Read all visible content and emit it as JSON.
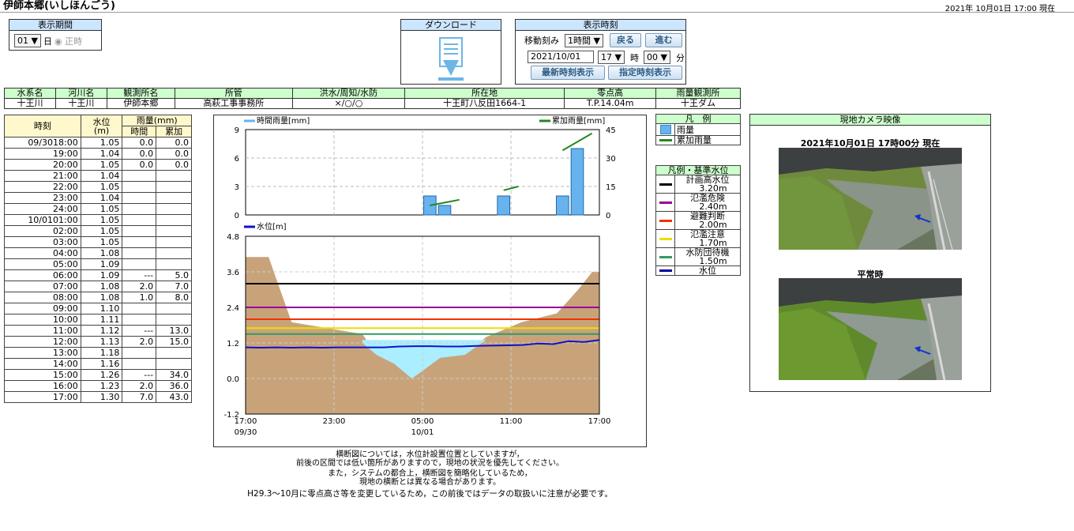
{
  "header": {
    "title": "伊師本郷(いしほんごう)",
    "current": "2021年 10月01日 17:00 現在"
  },
  "period": {
    "title": "表示期間",
    "value": "01",
    "unit": "日",
    "radio_label": "正時"
  },
  "download": {
    "title": "ダウンロード",
    "icon": "download-icon"
  },
  "display_time": {
    "title": "表示時刻",
    "step_label": "移動刻み",
    "step_value": "1時間",
    "back": "戻る",
    "forward": "進む",
    "date": "2021/10/01",
    "hour": "17",
    "hour_unit": "時",
    "minute": "00",
    "minute_unit": "分",
    "latest": "最新時刻表示",
    "specified": "指定時刻表示"
  },
  "station": {
    "headers": [
      "水系名",
      "河川名",
      "観測所名",
      "所管",
      "洪水/周知/水防",
      "所在地",
      "零点高",
      "雨量観測所"
    ],
    "values": [
      "十王川",
      "十王川",
      "伊師本郷",
      "高萩工事事務所",
      "×/○/○",
      "十王町八反田1664-1",
      "T.P.14.04m",
      "十王ダム"
    ]
  },
  "table": {
    "h_time": "時刻",
    "h_level": "水位",
    "h_level_unit": "(m)",
    "h_rain": "雨量(mm)",
    "h_hour": "時間",
    "h_cum": "累加",
    "rows": [
      [
        "09/30",
        "18:00",
        "1.05",
        "0.0",
        "0.0"
      ],
      [
        "",
        "19:00",
        "1.04",
        "0.0",
        "0.0"
      ],
      [
        "",
        "20:00",
        "1.05",
        "0.0",
        "0.0"
      ],
      [
        "",
        "21:00",
        "1.04",
        "",
        ""
      ],
      [
        "",
        "22:00",
        "1.05",
        "",
        ""
      ],
      [
        "",
        "23:00",
        "1.04",
        "",
        ""
      ],
      [
        "",
        "24:00",
        "1.05",
        "",
        ""
      ],
      [
        "10/01",
        "01:00",
        "1.05",
        "",
        ""
      ],
      [
        "",
        "02:00",
        "1.05",
        "",
        ""
      ],
      [
        "",
        "03:00",
        "1.05",
        "",
        ""
      ],
      [
        "",
        "04:00",
        "1.08",
        "",
        ""
      ],
      [
        "",
        "05:00",
        "1.09",
        "",
        ""
      ],
      [
        "",
        "06:00",
        "1.09",
        "---",
        "5.0"
      ],
      [
        "",
        "07:00",
        "1.08",
        "2.0",
        "7.0"
      ],
      [
        "",
        "08:00",
        "1.08",
        "1.0",
        "8.0"
      ],
      [
        "",
        "09:00",
        "1.10",
        "",
        ""
      ],
      [
        "",
        "10:00",
        "1.11",
        "",
        ""
      ],
      [
        "",
        "11:00",
        "1.12",
        "---",
        "13.0"
      ],
      [
        "",
        "12:00",
        "1.13",
        "2.0",
        "15.0"
      ],
      [
        "",
        "13:00",
        "1.18",
        "",
        ""
      ],
      [
        "",
        "14:00",
        "1.16",
        "",
        ""
      ],
      [
        "",
        "15:00",
        "1.26",
        "---",
        "34.0"
      ],
      [
        "",
        "16:00",
        "1.23",
        "2.0",
        "36.0"
      ],
      [
        "",
        "17:00",
        "1.30",
        "7.0",
        "43.0"
      ]
    ]
  },
  "chart_data": [
    {
      "type": "bar",
      "legend": [
        "時間雨量[mm]",
        "累加雨量[mm]"
      ],
      "colors": {
        "hourly": "#66b3ee",
        "cumulative": "#228822"
      },
      "ylim": [
        0,
        9
      ],
      "y2lim": [
        0,
        45
      ],
      "yticks": [
        "9",
        "6",
        "3",
        "0"
      ],
      "y2ticks": [
        "45",
        "30",
        "15",
        "0"
      ],
      "hourly_x": [
        13,
        14,
        18,
        22,
        23
      ],
      "hourly": [
        2.0,
        1.0,
        2.0,
        2.0,
        7.0
      ],
      "cumulative_segments": [
        [
          [
            12.5,
            5.0
          ],
          [
            14.5,
            8.0
          ]
        ],
        [
          [
            17.5,
            13.0
          ],
          [
            18.5,
            15.0
          ]
        ],
        [
          [
            21.5,
            34.0
          ],
          [
            23.5,
            43.0
          ]
        ]
      ]
    },
    {
      "type": "line",
      "legend": "水位[m]",
      "ylim": [
        -1.2,
        4.8
      ],
      "yticks": [
        "4.8",
        "3.6",
        "2.4",
        "1.2",
        "0.0",
        "-1.2"
      ],
      "xticks": [
        "17:00",
        "23:00",
        "05:00",
        "11:00",
        "17:00"
      ],
      "xdates": [
        "09/30",
        "",
        "10/01",
        "",
        ""
      ],
      "thresholds": [
        {
          "value": 3.2,
          "color": "#000000"
        },
        {
          "value": 2.4,
          "color": "#990099"
        },
        {
          "value": 2.0,
          "color": "#ee3300"
        },
        {
          "value": 1.7,
          "color": "#eedd00"
        },
        {
          "value": 1.5,
          "color": "#339966"
        }
      ],
      "level": [
        1.05,
        1.04,
        1.05,
        1.04,
        1.05,
        1.04,
        1.05,
        1.05,
        1.05,
        1.05,
        1.08,
        1.09,
        1.09,
        1.08,
        1.08,
        1.1,
        1.11,
        1.12,
        1.13,
        1.18,
        1.16,
        1.26,
        1.23,
        1.3
      ]
    }
  ],
  "legend_rain": {
    "title": "凡　例",
    "items": [
      {
        "label": "雨量",
        "color": "#66b3ee"
      },
      {
        "label": "累加雨量",
        "color": "#228822"
      }
    ]
  },
  "legend_level": {
    "title": "凡例・基準水位",
    "items": [
      {
        "label": "計画高水位",
        "value": "3.20m",
        "color": "#000000"
      },
      {
        "label": "氾濫危険",
        "value": "2.40m",
        "color": "#990099"
      },
      {
        "label": "避難判断",
        "value": "2.00m",
        "color": "#ee3300"
      },
      {
        "label": "氾濫注意",
        "value": "1.70m",
        "color": "#eedd00"
      },
      {
        "label": "水防団待機",
        "value": "1.50m",
        "color": "#339966"
      },
      {
        "label": "水位",
        "value": "",
        "color": "#000099"
      }
    ]
  },
  "camera": {
    "title": "現地カメラ映像",
    "caption1": "2021年10月01日 17時00分 現在",
    "caption2": "平常時"
  },
  "notes": [
    "横断図については，水位計設置位置としていますが，",
    "前後の区間では低い箇所がありますので，現地の状況を優先してください。",
    "また，システムの都合上，横断図を簡略化しているため，",
    "現地の横断とは異なる場合があります。",
    "H29.3～10月に零点高さ等を変更しているため，この前後ではデータの取扱いに注意が必要です。"
  ]
}
